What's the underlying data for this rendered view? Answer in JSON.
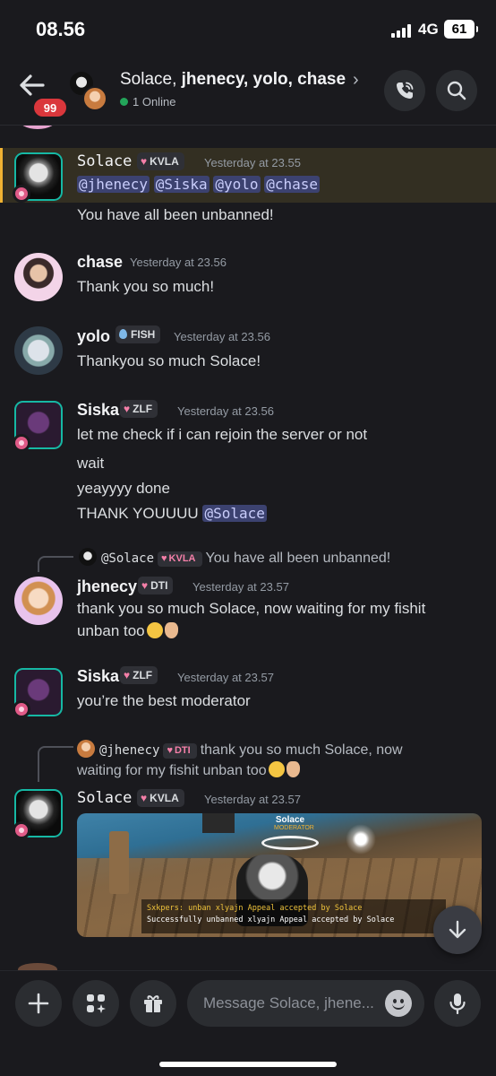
{
  "status_bar": {
    "time": "08.56",
    "network": "4G",
    "battery": "61"
  },
  "header": {
    "unread_badge": "99",
    "title_first": "Solace,",
    "title_rest": " jhenecy, yolo, chase",
    "chevron": "›",
    "online_status": "1 Online"
  },
  "messages": [
    {
      "user": "Solace",
      "tag": "KVLA",
      "time": "Yesterday at 23.55",
      "mentions": [
        "@jhenecy",
        "@Siska",
        "@yolo",
        "@chase"
      ],
      "text": "You have all been unbanned!"
    },
    {
      "user": "chase",
      "time": "Yesterday at 23.56",
      "text": "Thank you so much!"
    },
    {
      "user": "yolo",
      "tag": "FISH",
      "time": "Yesterday at 23.56",
      "text": "Thankyou so much Solace!"
    },
    {
      "user": "Siska",
      "tag": "ZLF",
      "time": "Yesterday at 23.56",
      "lines": [
        "let me check if i can rejoin the server or not",
        "wait",
        "yeayyyy done"
      ],
      "last_line": "THANK YOUUUU",
      "last_mention": "@Solace"
    },
    {
      "reply_name": "@Solace",
      "reply_tag": "KVLA",
      "reply_text": "You have all been unbanned!",
      "user": "jhenecy",
      "tag": "DTI",
      "time": "Yesterday at 23.57",
      "line1": "thank you so much Solace, now waiting for my fishit",
      "line2": "unban too"
    },
    {
      "user": "Siska",
      "tag": "ZLF",
      "time": "Yesterday at 23.57",
      "text": "you’re the best moderator"
    },
    {
      "reply_name": "@jhenecy",
      "reply_tag": "DTI",
      "reply_line1": "thank you so much Solace, now",
      "reply_line2": "waiting for my fishit unban too",
      "user": "Solace",
      "tag": "KVLA",
      "time": "Yesterday at 23.57",
      "image": {
        "player_name": "Solace",
        "player_sub": "MODERATOR",
        "log_line1_name": "Sxkpers:",
        "log_line1_text": " unban xlyajn Appeal accepted by Solace",
        "log_line2": "Successfully unbanned xlyajn Appeal accepted by Solace"
      }
    }
  ],
  "composer": {
    "placeholder": "Message Solace, jhene..."
  },
  "colors": {
    "online": "#23a55a",
    "badge": "#da373c",
    "highlight_bar": "#f0b232",
    "mention_bg": "#3c4270"
  },
  "icons": [
    "back-arrow-icon",
    "phone-icon",
    "search-icon",
    "plus-icon",
    "apps-icon",
    "gift-icon",
    "emoji-icon",
    "mic-icon",
    "arrow-down-icon"
  ]
}
